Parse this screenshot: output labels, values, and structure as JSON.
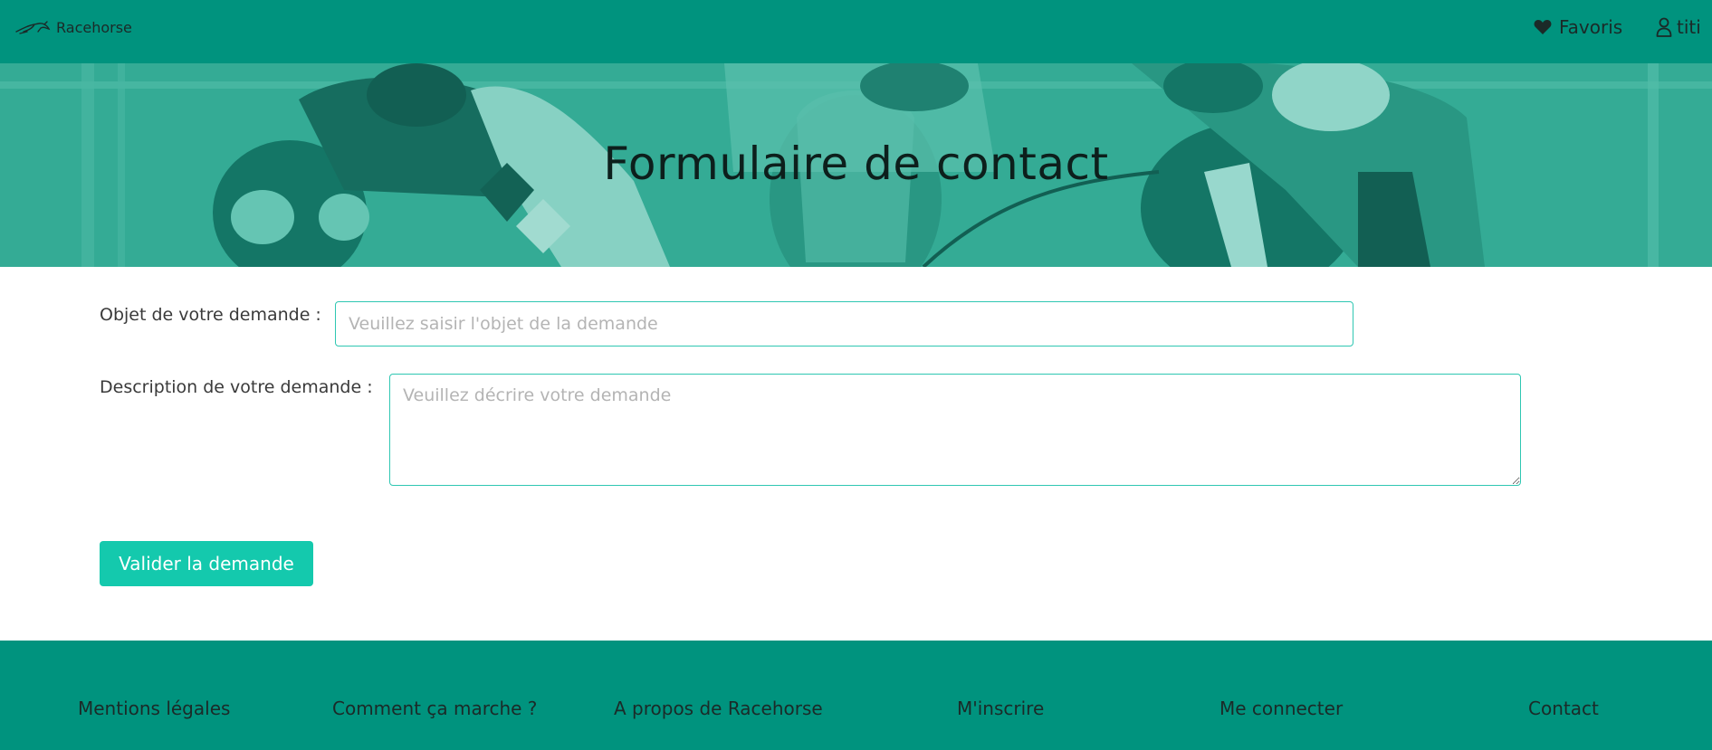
{
  "header": {
    "brand": "Racehorse",
    "brand_icon": "horse-logo-icon",
    "favorites_label": "Favoris",
    "favorites_icon": "heart-icon",
    "user_label": "titi",
    "user_icon": "user-icon"
  },
  "banner": {
    "title": "Formulaire de contact"
  },
  "form": {
    "subject_label": "Objet de votre demande :",
    "subject_placeholder": "Veuillez saisir l'objet de la demande",
    "subject_value": "",
    "description_label": "Description de votre demande :",
    "description_placeholder": "Veuillez décrire votre demande",
    "description_value": "",
    "submit_label": "Valider la demande"
  },
  "footer": {
    "links": [
      "Mentions légales",
      "Comment ça marche ?",
      "A propos de Racehorse",
      "M'inscrire",
      "Me connecter",
      "Contact"
    ]
  },
  "colors": {
    "header_bg": "#00937e",
    "banner_tint": "#3fb09c",
    "accent": "#14c9ad",
    "field_border": "#2fc7b2",
    "footer_bg": "#00937e"
  }
}
